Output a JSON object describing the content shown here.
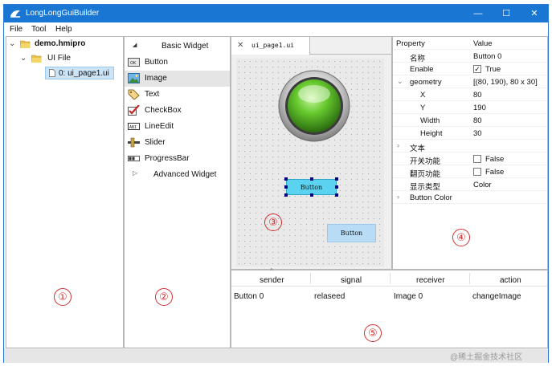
{
  "window": {
    "title": "LongLongGuiBuilder",
    "minimize_glyph": "—",
    "maximize_glyph": "☐",
    "close_glyph": "✕"
  },
  "menu": [
    "File",
    "Tool",
    "Help"
  ],
  "project_tree": {
    "root_toggle": "⌄",
    "root": "demo.hmipro",
    "child_toggle": "⌄",
    "child": "UI File",
    "leaf": "0: ui_page1.ui"
  },
  "widget_box": {
    "basic_toggle": "◢",
    "basic_header": "Basic Widget",
    "items": [
      "Button",
      "Image",
      "Text",
      "CheckBox",
      "LineEdit",
      "Slider",
      "ProgressBar"
    ],
    "advanced_toggle": "▷",
    "advanced_header": "Advanced Widget"
  },
  "editor": {
    "tab_close": "✕",
    "tab_title": "ui_page1.ui",
    "button_selected_label": "Button",
    "button2_label": "Button"
  },
  "properties": {
    "header_property": "Property",
    "header_value": "Value",
    "rows": {
      "name_key": "名称",
      "name_val": "Button 0",
      "enable_key": "Enable",
      "enable_check": "✓",
      "enable_val": "True",
      "geometry_toggle": "⌄",
      "geometry_key": "geometry",
      "geometry_val": "[(80, 190), 80 x 30]",
      "x_key": "X",
      "x_val": "80",
      "y_key": "Y",
      "y_val": "190",
      "w_key": "Width",
      "w_val": "80",
      "h_key": "Height",
      "h_val": "30",
      "text_toggle": "›",
      "text_key": "文本",
      "switch_key": "开关功能",
      "switch_val": "False",
      "page_key": "翻页功能",
      "page_val": "False",
      "display_key": "显示类型",
      "display_val": "Color",
      "bcolor_toggle": "›",
      "bcolor_key": "Button Color"
    }
  },
  "signals": {
    "collapse_glyph": "^",
    "headers": [
      "sender",
      "signal",
      "receiver",
      "action"
    ],
    "row": [
      "Button 0",
      "relaseed",
      "Image 0",
      "changeImage"
    ]
  },
  "annotations": [
    "①",
    "②",
    "③",
    "④",
    "⑤"
  ],
  "watermark": "@稀土掘金技术社区",
  "colors": {
    "titlebar": "#1976d2",
    "annotation": "#d32f2f",
    "button_fill": "#5bd3f0",
    "button2_fill": "#b9dcf6",
    "selection": "#cce4f7"
  }
}
